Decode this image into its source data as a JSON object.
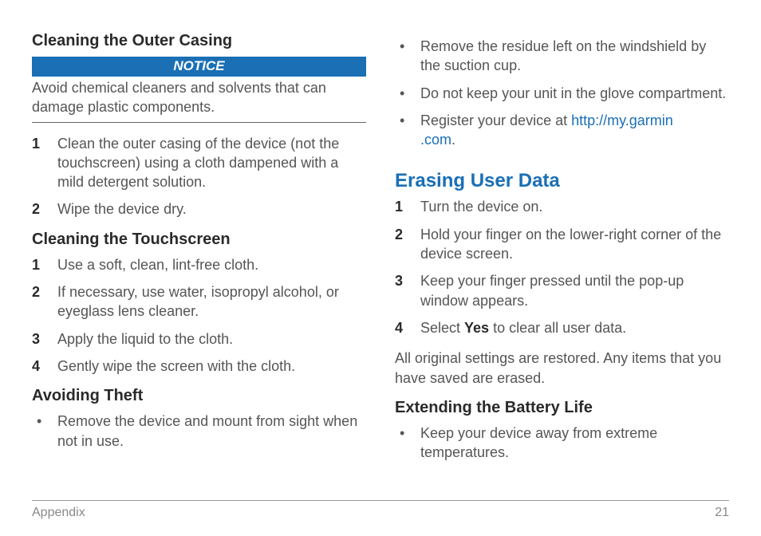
{
  "left": {
    "h_outer": "Cleaning the Outer Casing",
    "notice_label": "NOTICE",
    "notice_text": "Avoid chemical cleaners and solvents that can damage plastic components.",
    "outer_steps": [
      "Clean the outer casing of the device (not the touchscreen) using a cloth dampened with a mild detergent solution.",
      "Wipe the device dry."
    ],
    "h_touch": "Cleaning the Touchscreen",
    "touch_steps": [
      "Use a soft, clean, lint-free cloth.",
      "If necessary, use water, isopropyl alcohol, or eyeglass lens cleaner.",
      "Apply the liquid to the cloth.",
      "Gently wipe the screen with the cloth."
    ],
    "h_theft": "Avoiding Theft",
    "theft_bullets": [
      "Remove the device and mount from sight when not in use."
    ]
  },
  "right": {
    "top_bullets": [
      "Remove the residue left on the windshield by the suction cup.",
      "Do not keep your unit in the glove compartment."
    ],
    "register_pre": "Register your device at ",
    "register_link_1": "http://my.garmin",
    "register_link_2": ".com",
    "register_post": ".",
    "h_erase": "Erasing User Data",
    "erase_steps": [
      "Turn the device on.",
      "Hold your finger on the lower-right corner of the device screen.",
      "Keep your finger pressed until the pop-up window appears."
    ],
    "erase_step4_pre": "Select ",
    "erase_step4_bold": "Yes",
    "erase_step4_post": " to clear all user data.",
    "erase_result": "All original settings are restored. Any items that you have saved are erased.",
    "h_battery": "Extending the Battery Life",
    "battery_bullets": [
      "Keep your device away from extreme temperatures."
    ]
  },
  "footer": {
    "section": "Appendix",
    "page": "21"
  }
}
